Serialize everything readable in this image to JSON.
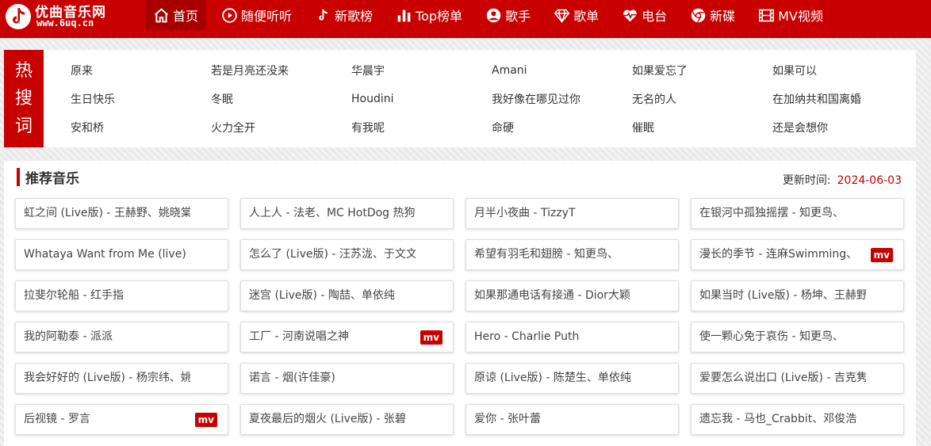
{
  "logo": {
    "title": "优曲音乐网",
    "url": "www.6uq.cn",
    "icon": "tiktok-note-icon"
  },
  "nav": [
    {
      "label": "首页",
      "icon": "home-icon",
      "active": true
    },
    {
      "label": "随便听听",
      "icon": "play-circle-icon"
    },
    {
      "label": "新歌榜",
      "icon": "tiktok-icon"
    },
    {
      "label": "Top榜单",
      "icon": "bar-chart-icon"
    },
    {
      "label": "歌手",
      "icon": "user-icon"
    },
    {
      "label": "歌单",
      "icon": "diamond-icon"
    },
    {
      "label": "电台",
      "icon": "heartbeat-icon"
    },
    {
      "label": "新碟",
      "icon": "chrome-icon"
    },
    {
      "label": "MV视频",
      "icon": "film-icon"
    }
  ],
  "hot": {
    "label": [
      "热",
      "搜",
      "词"
    ],
    "items": [
      "原来",
      "若是月亮还没来",
      "华晨宇",
      "Amani",
      "如果爱忘了",
      "如果可以",
      "生日快乐",
      "冬眠",
      "Houdini",
      "我好像在哪见过你",
      "无名的人",
      "在加纳共和国离婚",
      "安和桥",
      "火力全开",
      "有我呢",
      "命硬",
      "催眠",
      "还是会想你"
    ]
  },
  "recommend": {
    "title": "推荐音乐",
    "update_label": "更新时间:",
    "update_date": "2024-06-03",
    "mv_label": "mv",
    "songs": [
      {
        "name": "虹之间 (Live版) - 王赫野、姚晓棠",
        "mv": false
      },
      {
        "name": "人上人 - 法老、MC HotDog 热狗",
        "mv": false
      },
      {
        "name": "月半小夜曲 - TizzyT",
        "mv": false
      },
      {
        "name": "在银河中孤独摇摆 - 知更鸟、",
        "mv": false
      },
      {
        "name": "Whataya Want from Me (live) -",
        "mv": false
      },
      {
        "name": "怎么了 (Live版) - 汪苏泷、于文文",
        "mv": false
      },
      {
        "name": "希望有羽毛和翅膀 - 知更鸟、",
        "mv": false
      },
      {
        "name": "漫长的季节 - 连麻Swimming、",
        "mv": true
      },
      {
        "name": "拉斐尔轮船 - 红手指",
        "mv": false
      },
      {
        "name": "迷宫 (Live版) - 陶喆、单依纯",
        "mv": false
      },
      {
        "name": "如果那通电话有接通 - Dior大颖",
        "mv": false
      },
      {
        "name": "如果当时 (Live版) - 杨坤、王赫野",
        "mv": false
      },
      {
        "name": "我的阿勒泰 - 派派",
        "mv": false
      },
      {
        "name": "工厂 - 河南说唱之神",
        "mv": true
      },
      {
        "name": "Hero - Charlie Puth",
        "mv": false
      },
      {
        "name": "使一颗心免于哀伤 - 知更鸟、",
        "mv": false
      },
      {
        "name": "我会好好的 (Live版) - 杨宗纬、姚",
        "mv": false
      },
      {
        "name": "诺言 - 烟(许佳豪)",
        "mv": false
      },
      {
        "name": "原谅 (Live版) - 陈楚生、单依纯",
        "mv": false
      },
      {
        "name": "爱要怎么说出口 (Live版) - 吉克隽",
        "mv": false
      },
      {
        "name": "后视镜 - 罗言",
        "mv": true
      },
      {
        "name": "夏夜最后的烟火 (Live版) - 张碧",
        "mv": false
      },
      {
        "name": "爱你 - 张叶蕾",
        "mv": false
      },
      {
        "name": "遗忘我 - 马也_Crabbit、邓俊浩",
        "mv": false
      }
    ]
  },
  "colors": {
    "brand_red": "#c80000",
    "active_nav": "#a80000"
  }
}
